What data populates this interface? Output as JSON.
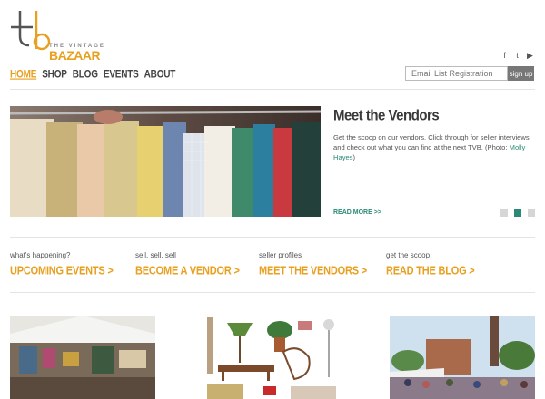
{
  "header": {
    "logo_mark": "tb",
    "logo_small": "THE VINTAGE",
    "logo_big": "BAZAAR",
    "nav": [
      {
        "label": "HOME",
        "active": true
      },
      {
        "label": "SHOP",
        "active": false
      },
      {
        "label": "BLOG",
        "active": false
      },
      {
        "label": "EVENTS",
        "active": false
      },
      {
        "label": "ABOUT",
        "active": false
      }
    ],
    "social_icons": [
      "facebook-icon",
      "twitter-icon",
      "youtube-icon"
    ],
    "social_glyphs": [
      "f",
      "t",
      "▶"
    ],
    "email_placeholder": "Email List Registration",
    "signup_label": "sign up"
  },
  "feature": {
    "title": "Meet the Vendors",
    "body": "Get the scoop on our vendors. Click through for seller interviews and check out what you can find at the next TVB. (Photo: ",
    "credit": "Molly Hayes",
    "body_end": ")",
    "read_more": "READ MORE >>",
    "slides": 3,
    "active_slide": 2
  },
  "promos": [
    {
      "small": "what's happening?",
      "big": "UPCOMING EVENTS >"
    },
    {
      "small": "sell, sell, sell",
      "big": "BECOME A VENDOR >"
    },
    {
      "small": "seller profiles",
      "big": "MEET THE VENDORS >"
    },
    {
      "small": "get the scoop",
      "big": "READ THE BLOG >"
    }
  ],
  "colors": {
    "accent": "#e8a020",
    "teal": "#2a8a76",
    "text": "#555555"
  }
}
